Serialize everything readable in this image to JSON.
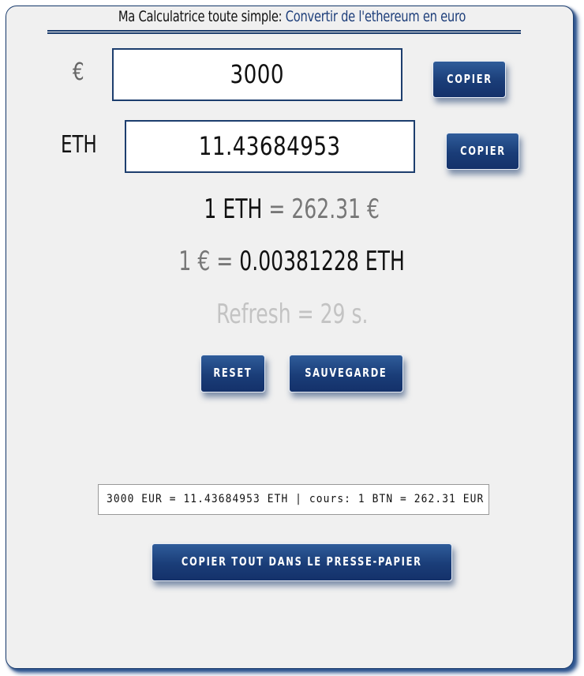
{
  "header": {
    "title_prefix": "Ma Calculatrice toute simple: ",
    "title_accent": "Convertir de l'ethereum en euro"
  },
  "inputs": {
    "euro": {
      "label": "€",
      "value": "3000",
      "copy_label": "COPIER"
    },
    "eth": {
      "label": "ETH",
      "value": "11.43684953",
      "copy_label": "COPIER"
    }
  },
  "rates": {
    "eth_to_eur": {
      "left": "1 ETH",
      "eq": " = ",
      "right": "262.31 €"
    },
    "eur_to_eth": {
      "left": "1 €",
      "eq": " = ",
      "right": "0.00381228 ETH"
    },
    "refresh": "Refresh = 29 s."
  },
  "actions": {
    "reset_label": "RESET",
    "save_label": "SAUVEGARDE"
  },
  "summary": {
    "text": "3000 EUR = 11.43684953 ETH   |   cours: 1 BTN = 262.31 EUR"
  },
  "copy_all_label": "COPIER TOUT DANS LE PRESSE-PAPIER",
  "colors": {
    "accent": "#1d3e6e",
    "button": "#1a3d78",
    "background": "#f0f0f0"
  }
}
